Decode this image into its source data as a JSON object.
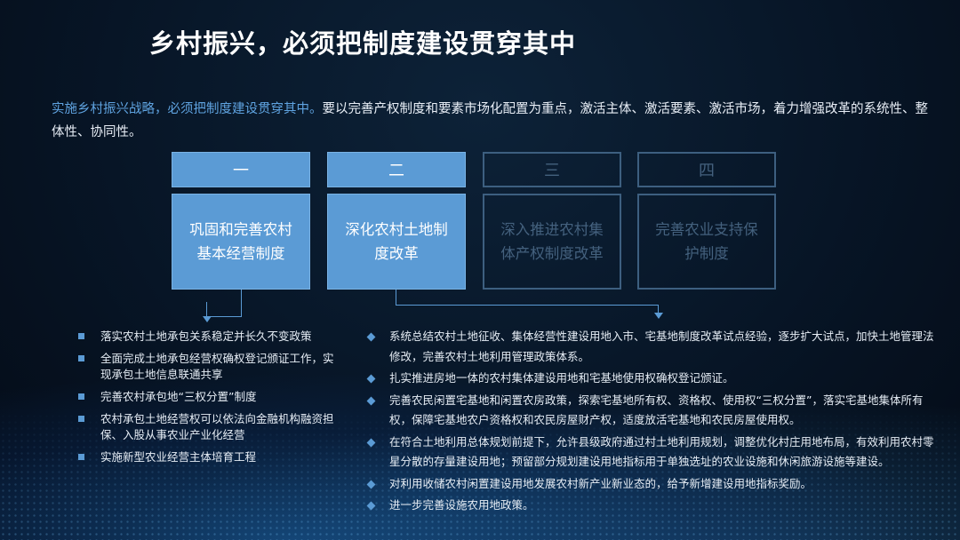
{
  "title": "乡村振兴，必须把制度建设贯穿其中",
  "intro": {
    "highlight": "实施乡村振兴战略，必须把制度建设贯穿其中。",
    "text": "要以完善产权制度和要素市场化配置为重点，激活主体、激活要素、激活市场，着力增强改革的系统性、整体性、协同性。"
  },
  "columns": [
    {
      "number": "一",
      "label": "巩固和完善农村基本经营制度",
      "active": true
    },
    {
      "number": "二",
      "label": "深化农村土地制度改革",
      "active": true
    },
    {
      "number": "三",
      "label": "深入推进农村集体产权制度改革",
      "active": false
    },
    {
      "number": "四",
      "label": "完善农业支持保护制度",
      "active": false
    }
  ],
  "left_items": [
    "落实农村土地承包关系稳定并长久不变政策",
    "全面完成土地承包经营权确权登记颁证工作，实现承包土地信息联通共享",
    "完善农村承包地“三权分置”制度",
    "农村承包土地经营权可以依法向金融机构融资担保、入股从事农业产业化经营",
    "实施新型农业经营主体培育工程"
  ],
  "right_items": [
    "系统总结农村土地征收、集体经营性建设用地入市、宅基地制度改革试点经验，逐步扩大试点，加快土地管理法修改，完善农村土地利用管理政策体系。",
    "扎实推进房地一体的农村集体建设用地和宅基地使用权确权登记颁证。",
    "完善农民闲置宅基地和闲置农房政策，探索宅基地所有权、资格权、使用权“三权分置”，落实宅基地集体所有权，保障宅基地农户资格权和农民房屋财产权，适度放活宅基地和农民房屋使用权。",
    "在符合土地利用总体规划前提下，允许县级政府通过村土地利用规划，调整优化村庄用地布局，有效利用农村零星分散的存量建设用地；预留部分规划建设用地指标用于单独选址的农业设施和休闲旅游设施等建设。",
    "对利用收储农村闲置建设用地发展农村新产业新业态的，给予新增建设用地指标奖励。",
    "进一步完善设施农用地政策。"
  ],
  "colors": {
    "accent": "#5b9bd5",
    "inactive": "#3d5f80",
    "highlight": "#5fa3e0"
  }
}
